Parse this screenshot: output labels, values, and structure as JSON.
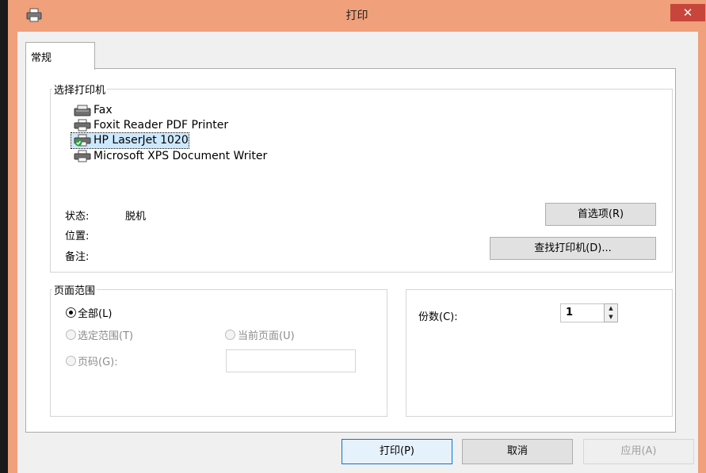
{
  "window": {
    "title": "打印",
    "close_glyph": "✕",
    "icon": "printer-icon"
  },
  "tabs": [
    {
      "label": "常规"
    }
  ],
  "select_printer": {
    "group_label": "选择打印机",
    "printers": [
      {
        "name": "Fax",
        "icon": "fax-icon"
      },
      {
        "name": "Foxit Reader PDF Printer",
        "icon": "printer-icon"
      },
      {
        "name": "HP LaserJet 1020",
        "icon": "printer-default-icon",
        "selected": true
      },
      {
        "name": "Microsoft XPS Document Writer",
        "icon": "printer-icon"
      }
    ],
    "status_label": "状态:",
    "status_value": "脱机",
    "location_label": "位置:",
    "location_value": "",
    "comment_label": "备注:",
    "comment_value": "",
    "preferences_button": "首选项(R)",
    "find_printer_button": "查找打印机(D)..."
  },
  "page_range": {
    "group_label": "页面范围",
    "all_label": "全部(L)",
    "selection_label": "选定范围(T)",
    "current_page_label": "当前页面(U)",
    "pages_label": "页码(G):",
    "pages_value": ""
  },
  "copies": {
    "label": "份数(C):",
    "value": "1"
  },
  "footer": {
    "print_button": "打印(P)",
    "cancel_button": "取消",
    "apply_button": "应用(A)"
  },
  "colors": {
    "titlebar": "#f0a07a",
    "close_button": "#c7453a",
    "selection": "#cce8ff",
    "default_button_border": "#0078d7"
  }
}
